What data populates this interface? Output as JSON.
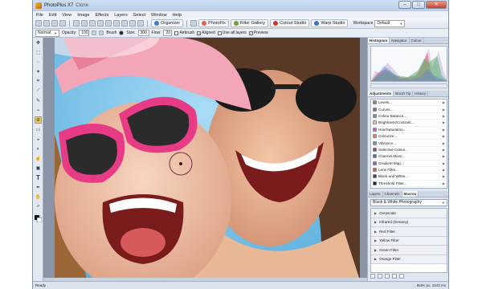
{
  "app": {
    "title": "PhotoPlus X7",
    "document": "Clone"
  },
  "window_controls": {
    "minimize": "–",
    "maximize": "□",
    "close": "✕"
  },
  "menu": [
    "File",
    "Edit",
    "View",
    "Image",
    "Effects",
    "Layers",
    "Select",
    "Window",
    "Help"
  ],
  "toolbar": {
    "organizer": "Organizer",
    "photofix": "PhotoFix",
    "filter_gallery": "Filter Gallery",
    "cutout_studio": "Cutout Studio",
    "warp_studio": "Warp Studio",
    "workspace_label": "Workspace",
    "workspace_value": "Default"
  },
  "context_bar": {
    "blend_mode": "Normal",
    "opacity_label": "Opacity:",
    "opacity_value": "100",
    "brush_label": "Brush",
    "size_label": "Size:",
    "size_value": "300",
    "flow_label": "Flow:",
    "flow_value": "20",
    "airbrush": "Airbrush",
    "aligned": "Aligned",
    "use_all_layers": "Use all layers",
    "preview": "Preview"
  },
  "panels": {
    "top_tabs": [
      "Histogram",
      "Navigator",
      "Colour"
    ],
    "mid_tabs": [
      "Adjustments",
      "Brush Tip",
      "History"
    ],
    "adjustments": [
      {
        "label": "Levels...",
        "color": "#7f8c9d"
      },
      {
        "label": "Curves...",
        "color": "#6c7a8c"
      },
      {
        "label": "Colour Balance...",
        "color": "#4f9bd6"
      },
      {
        "label": "Brightness/Contrast...",
        "color": "#f2d36b"
      },
      {
        "label": "Hue/Saturation...",
        "color": "#d65fb1"
      },
      {
        "label": "Colourize...",
        "color": "#e08b3c"
      },
      {
        "label": "Vibrance...",
        "color": "#59b84b"
      },
      {
        "label": "Selective Colour...",
        "color": "#c9392e"
      },
      {
        "label": "Channel Mixer...",
        "color": "#3b73c9"
      },
      {
        "label": "Gradient Map...",
        "color": "#8c5ad1"
      },
      {
        "label": "Lens Filter...",
        "color": "#e05a3c"
      },
      {
        "label": "Black and White...",
        "color": "#444444"
      },
      {
        "label": "Threshold Filter...",
        "color": "#222222"
      },
      {
        "label": "Posterize...",
        "color": "#8a6d3b"
      }
    ],
    "bottom_tabs": [
      "Layers",
      "Channels",
      "Macros"
    ],
    "macro_category": "Black & White Photography",
    "macros": [
      "Greyscale",
      "Infrared (Dreamy)",
      "Red Filter",
      "Yellow Filter",
      "Green Filter",
      "Orange Filter"
    ]
  },
  "status": {
    "left": "Ready",
    "right": "850K px, 1543 ms"
  },
  "icons": {
    "app": "photoplus-logo-icon",
    "tools": [
      "move-icon",
      "selection-icon",
      "lasso-icon",
      "magic-wand-icon",
      "crop-icon",
      "straighten-icon",
      "eyedropper-icon",
      "brush-icon",
      "clone-icon",
      "eraser-icon",
      "fill-icon",
      "dodge-icon",
      "smudge-icon",
      "shape-icon",
      "text-icon",
      "pen-icon",
      "hand-icon",
      "zoom-icon"
    ]
  }
}
